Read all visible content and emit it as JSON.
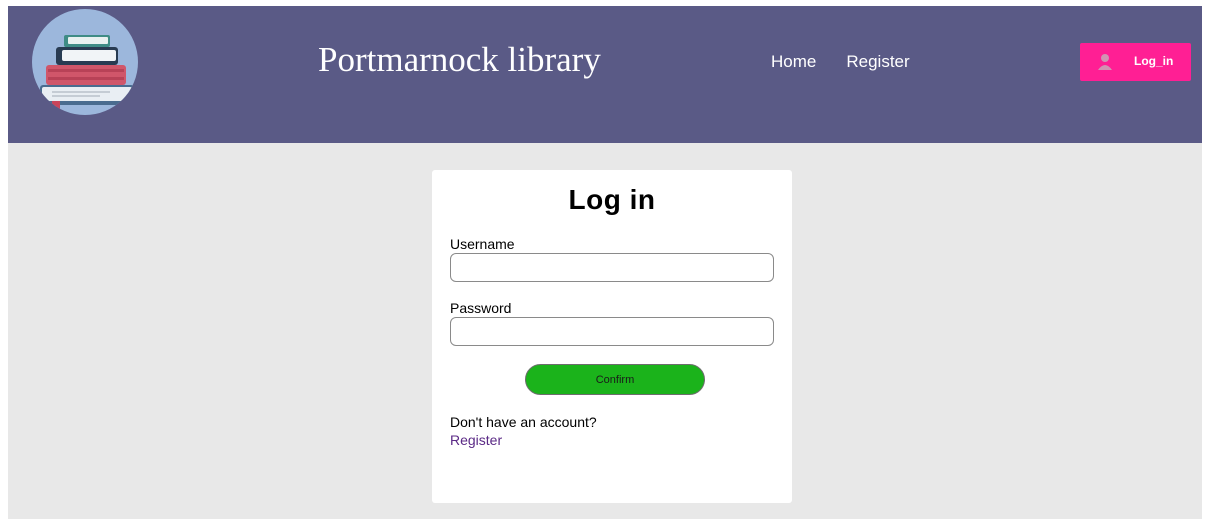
{
  "header": {
    "site_title": "Portmarnock library",
    "nav": [
      {
        "label": "Home"
      },
      {
        "label": "Register"
      }
    ],
    "login_button_label": "Log_in"
  },
  "login_form": {
    "title": "Log in",
    "username_label": "Username",
    "username_value": "",
    "password_label": "Password",
    "password_value": "",
    "confirm_label": "Confirm",
    "no_account_text": "Don't have an account?",
    "register_link": "Register"
  },
  "colors": {
    "header_bg": "#5a5a86",
    "page_bg": "#e8e8e8",
    "login_button": "#ff1f94",
    "confirm_button": "#1bb31b",
    "register_link": "#5b2a86"
  },
  "icons": {
    "logo": "books-stack-icon",
    "login_button_icon": "user-icon"
  }
}
